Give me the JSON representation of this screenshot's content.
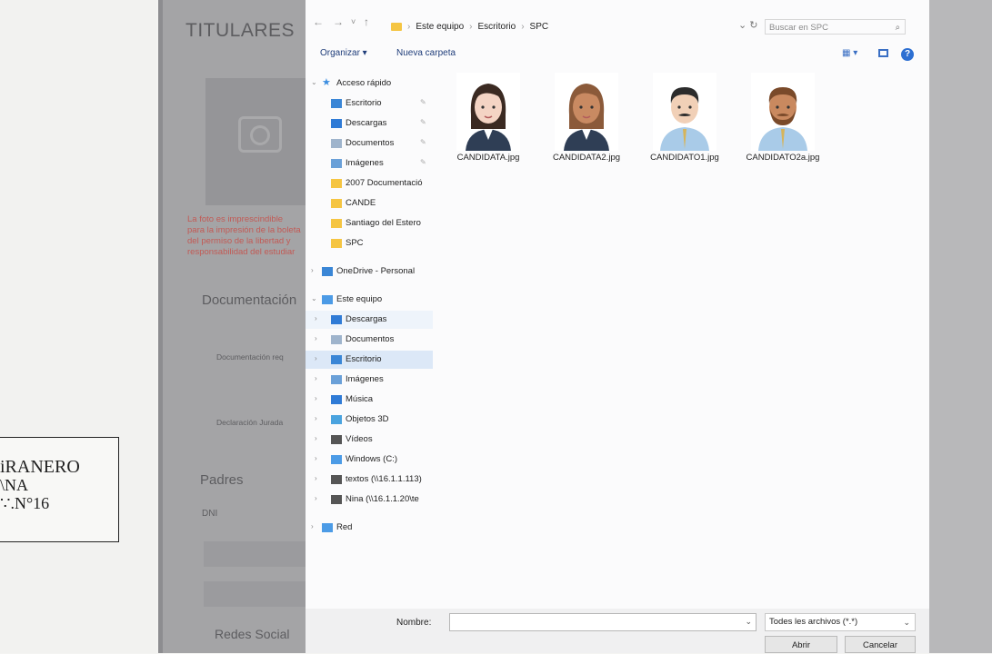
{
  "stamp": {
    "line1": "iRANERO",
    "line2": "\\NA",
    "line3": "∵.N°16"
  },
  "background_page": {
    "title": "TITULARES",
    "warning": "La foto es imprescindible para la impresión de la boleta del permiso de la libertad y responsabilidad del estudiar",
    "section_documentacion": "Documentación",
    "label_documentacion": "Documentación req",
    "label_declaracion": "Declaración Jurada",
    "section_padres": "Padres",
    "label_dni": "DNI",
    "section_redes": "Redes Social"
  },
  "dialog": {
    "nav": {
      "back": "←",
      "forward": "→",
      "recent": "˅",
      "up": "↑"
    },
    "breadcrumb": [
      "Este equipo",
      "Escritorio",
      "SPC"
    ],
    "refresh_icon": "refresh-icon",
    "search_placeholder": "Buscar en SPC",
    "toolbar": {
      "organize": "Organizar ▾",
      "new_folder": "Nueva carpeta"
    },
    "nav_tree": {
      "quick_access": "Acceso rápido",
      "quick_items": [
        "Escritorio",
        "Descargas",
        "Documentos",
        "Imágenes",
        "2007 Documentació",
        "CANDE",
        "Santiago del Estero",
        "SPC"
      ],
      "onedrive": "OneDrive - Personal",
      "this_pc": "Este equipo",
      "pc_items": [
        "Descargas",
        "Documentos",
        "Escritorio",
        "Imágenes",
        "Música",
        "Objetos 3D",
        "Vídeos",
        "Windows (C:)",
        "textos (\\\\16.1.1.113)",
        "Nina (\\\\16.1.1.20\\te"
      ],
      "network": "Red"
    },
    "files": [
      {
        "name": "CANDIDATA.jpg",
        "avatar": "woman-dark-hair",
        "hair": "#3b2a22",
        "skin": "#f4d4c4"
      },
      {
        "name": "CANDIDATA2.jpg",
        "avatar": "woman-brown-hair",
        "hair": "#8b5a3a",
        "skin": "#c98a62"
      },
      {
        "name": "CANDIDATO1.jpg",
        "avatar": "man-mustache-light",
        "hair": "#2c2c2c",
        "skin": "#f1d0b7"
      },
      {
        "name": "CANDIDATO2a.jpg",
        "avatar": "man-beard-tan",
        "hair": "#7a4a2a",
        "skin": "#c9895f"
      }
    ],
    "filename_label": "Nombre:",
    "filename_value": "",
    "filetype": "Todes les archivos (*.*)",
    "open_button": "Abrir",
    "cancel_button": "Cancelar"
  },
  "colors": {
    "accent": "#2d6fd2",
    "selection": "#dce8f7",
    "folder": "#f5c542"
  }
}
